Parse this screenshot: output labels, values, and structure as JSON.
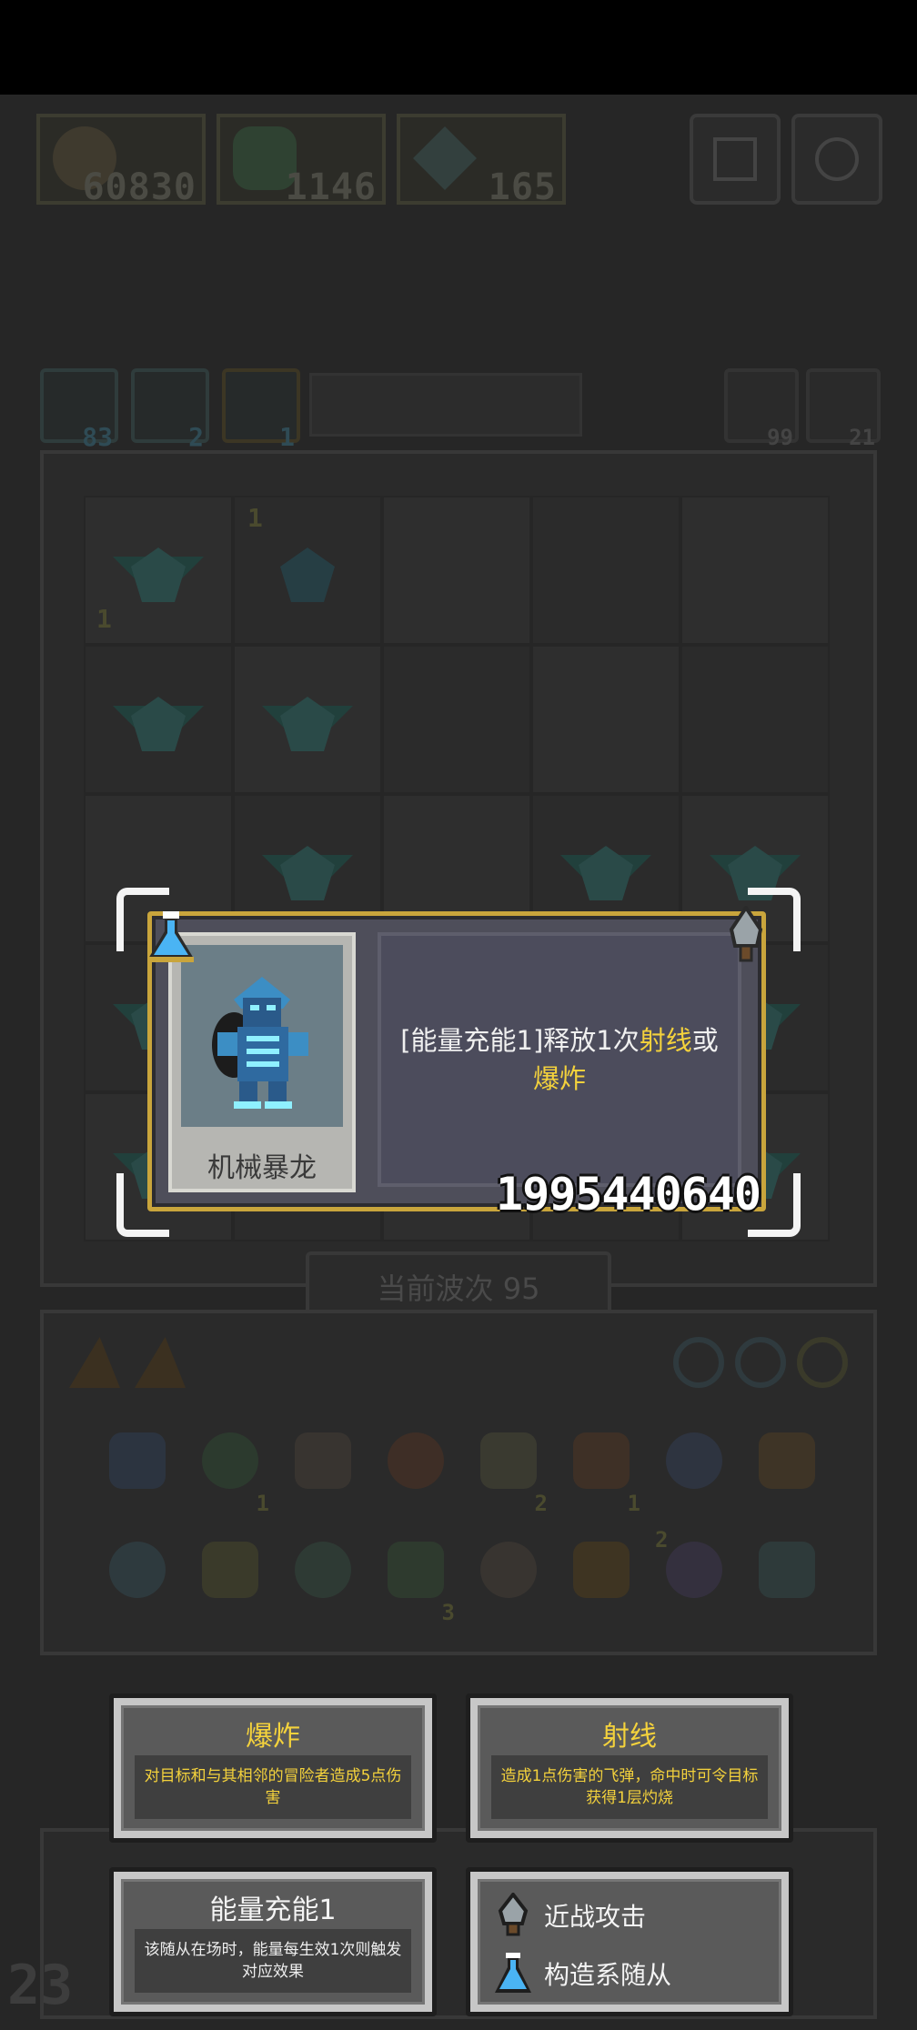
{
  "resources": {
    "gold": "60830",
    "gems": "1146",
    "wings": "165"
  },
  "skills": {
    "a_count": "83",
    "b_count": "2",
    "c_count": "1",
    "right_a_count": "99",
    "right_b_count": "21"
  },
  "board": {
    "cell_counts": [
      "1",
      "1"
    ]
  },
  "wave": {
    "label": "当前波次 95",
    "number": "23"
  },
  "inventory": {
    "counts": [
      "1",
      "2",
      "1",
      "3",
      "2"
    ]
  },
  "card": {
    "name": "机械暴龙",
    "desc_prefix": "[能量充能1]释放1次",
    "desc_kw1": "射线",
    "desc_mid": "或",
    "desc_kw2": "爆炸",
    "code": "1995440640"
  },
  "keywords": [
    {
      "title": "爆炸",
      "desc": "对目标和与其相邻的冒险者造成5点伤害"
    },
    {
      "title": "射线",
      "desc": "造成1点伤害的飞弹，命中时可令目标获得1层灼烧"
    },
    {
      "title": "能量充能1",
      "desc": "该随从在场时，能量每生效1次则触发对应效果"
    }
  ],
  "tags": {
    "melee": "近战攻击",
    "construct": "构造系随从"
  },
  "colors": {
    "highlight": "#f4d23c",
    "card_border": "#c9a53c",
    "background": "#262626"
  }
}
